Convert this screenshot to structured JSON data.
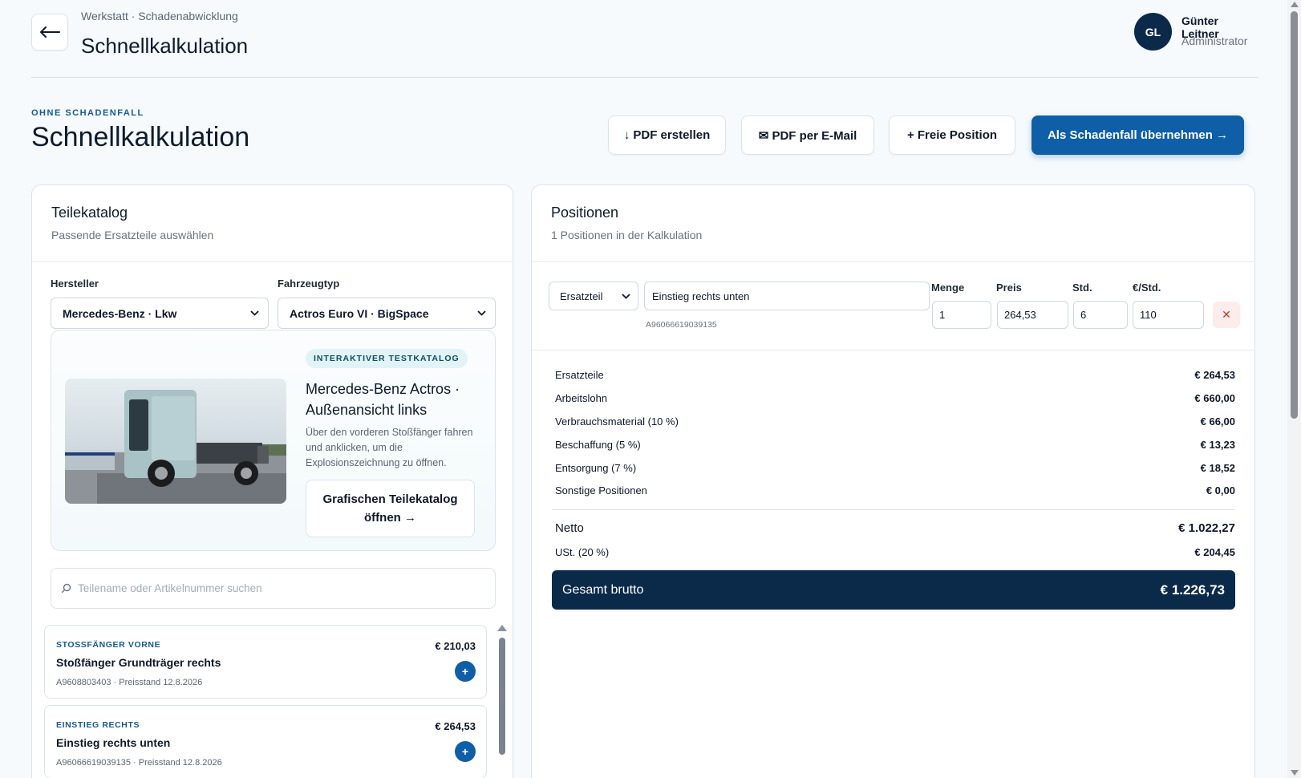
{
  "header": {
    "breadcrumb": "Werkstatt · Schadenabwicklung",
    "title": "Schnellkalkulation",
    "user": {
      "initials": "GL",
      "name": "Günter Leitner",
      "role": "Administrator"
    }
  },
  "page": {
    "eyebrow": "OHNE SCHADENFALL",
    "title": "Schnellkalkulation",
    "actions": {
      "pdf": "↓ PDF erstellen",
      "email": "✉ PDF per E-Mail",
      "free": "+ Freie Position",
      "primary": "Als Schadenfall übernehmen →"
    }
  },
  "catalog": {
    "title": "Teilekatalog",
    "subtitle": "Passende Ersatzteile auswählen",
    "manufacturer_label": "Hersteller",
    "manufacturer_value": "Mercedes-Benz · Lkw",
    "vehicle_label": "Fahrzeugtyp",
    "vehicle_value": "Actros Euro VI · BigSpace",
    "feature": {
      "badge": "INTERAKTIVER TESTKATALOG",
      "title": "Mercedes-Benz Actros · Außenansicht links",
      "text": "Über den vorderen Stoßfänger fahren und anklicken, um die Explosionszeichnung zu öffnen.",
      "button": "Grafischen Teilekatalog öffnen →"
    },
    "search_placeholder": "Teilename oder Artikelnummer suchen",
    "parts": [
      {
        "category": "STOSSFÄNGER VORNE",
        "name": "Stoßfänger Grundträger rechts",
        "meta": "A9608803403 · Preisstand 12.8.2026",
        "price": "€ 210,03"
      },
      {
        "category": "EINSTIEG RECHTS",
        "name": "Einstieg rechts unten",
        "meta": "A96066619039135 · Preisstand 12.8.2026",
        "price": "€ 264,53"
      }
    ]
  },
  "positions": {
    "title": "Positionen",
    "subtitle": "1 Positionen in der Kalkulation",
    "row": {
      "type": "Ersatzteil",
      "description": "Einstieg rechts unten",
      "article_no": "A96066619039135",
      "qty_label": "Menge",
      "qty": "1",
      "price_label": "Preis",
      "price": "264,53",
      "hours_label": "Std.",
      "hours": "6",
      "rate_label": "€/Std.",
      "rate": "110"
    },
    "summary": [
      {
        "label": "Ersatzteile",
        "value": "€ 264,53"
      },
      {
        "label": "Arbeitslohn",
        "value": "€ 660,00"
      },
      {
        "label": "Verbrauchsmaterial (10 %)",
        "value": "€ 66,00"
      },
      {
        "label": "Beschaffung (5 %)",
        "value": "€ 13,23"
      },
      {
        "label": "Entsorgung (7 %)",
        "value": "€ 18,52"
      },
      {
        "label": "Sonstige Positionen",
        "value": "€ 0,00"
      }
    ],
    "net_label": "Netto",
    "net_value": "€ 1.022,27",
    "vat_label": "USt. (20 %)",
    "vat_value": "€ 204,45",
    "total_label": "Gesamt brutto",
    "total_value": "€ 1.226,73"
  },
  "colors": {
    "primary": "#0f5ea8",
    "navy": "#0b2a4a",
    "danger": "#d0342c"
  }
}
